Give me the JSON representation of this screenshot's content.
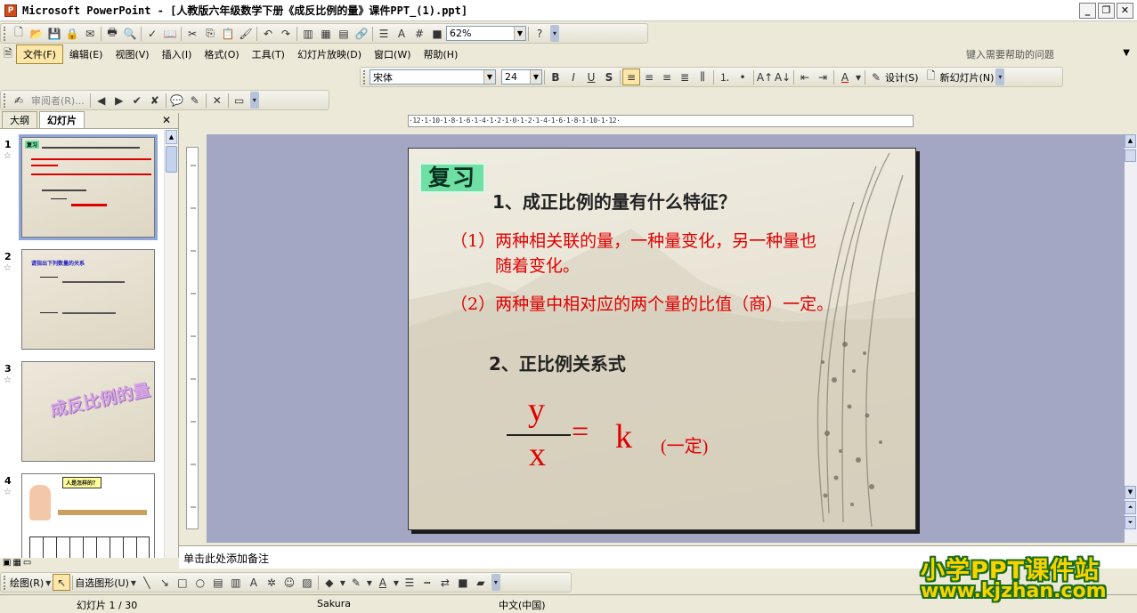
{
  "window": {
    "title": "Microsoft PowerPoint - [人教版六年级数学下册《成反比例的量》课件PPT_(1).ppt]"
  },
  "toolbar": {
    "zoom": "62%"
  },
  "menu": {
    "items": [
      "文件(F)",
      "编辑(E)",
      "视图(V)",
      "插入(I)",
      "格式(O)",
      "工具(T)",
      "幻灯片放映(D)",
      "窗口(W)",
      "帮助(H)"
    ],
    "help_placeholder": "键入需要帮助的问题"
  },
  "format_toolbar": {
    "font": "宋体",
    "size": "24",
    "design_label": "设计(S)",
    "new_slide_label": "新幻灯片(N)"
  },
  "review_toolbar": {
    "reviewer_label": "审阅者(R)..."
  },
  "panel": {
    "tabs": [
      "大纲",
      "幻灯片"
    ],
    "thumbnails": [
      {
        "num": "1",
        "title": "复习"
      },
      {
        "num": "2",
        "title": "请指出下列数量的关系"
      },
      {
        "num": "3",
        "title": "成反比例的量"
      },
      {
        "num": "4",
        "title": "人是怎样的？"
      }
    ]
  },
  "slide": {
    "badge": "复习",
    "heading1": "1、成正比例的量有什么特征？",
    "point1_line1": "（1）两种相关联的量，一种量变化，另一种量也",
    "point1_line2": "随着变化。",
    "point2": "（2）两种量中相对应的两个量的比值（商）一定。",
    "heading2": "2、正比例关系式",
    "numerator": "y",
    "denominator": "x",
    "equals": "=",
    "constant": "k",
    "constant_note": "(一定)"
  },
  "ruler": {
    "horizontal": "·12·1·10·1·8·1·6·1·4·1·2·1·0·1·2·1·4·1·6·1·8·1·10·1·12·"
  },
  "notes": {
    "placeholder": "单击此处添加备注"
  },
  "draw_toolbar": {
    "draw_label": "绘图(R)",
    "autoshapes_label": "自选图形(U)"
  },
  "status": {
    "slide_info": "幻灯片 1 / 30",
    "theme": "Sakura",
    "language": "中文(中国)"
  },
  "watermark": {
    "line1": "小学PPT课件站",
    "line2": "www.kjzhan.com"
  }
}
